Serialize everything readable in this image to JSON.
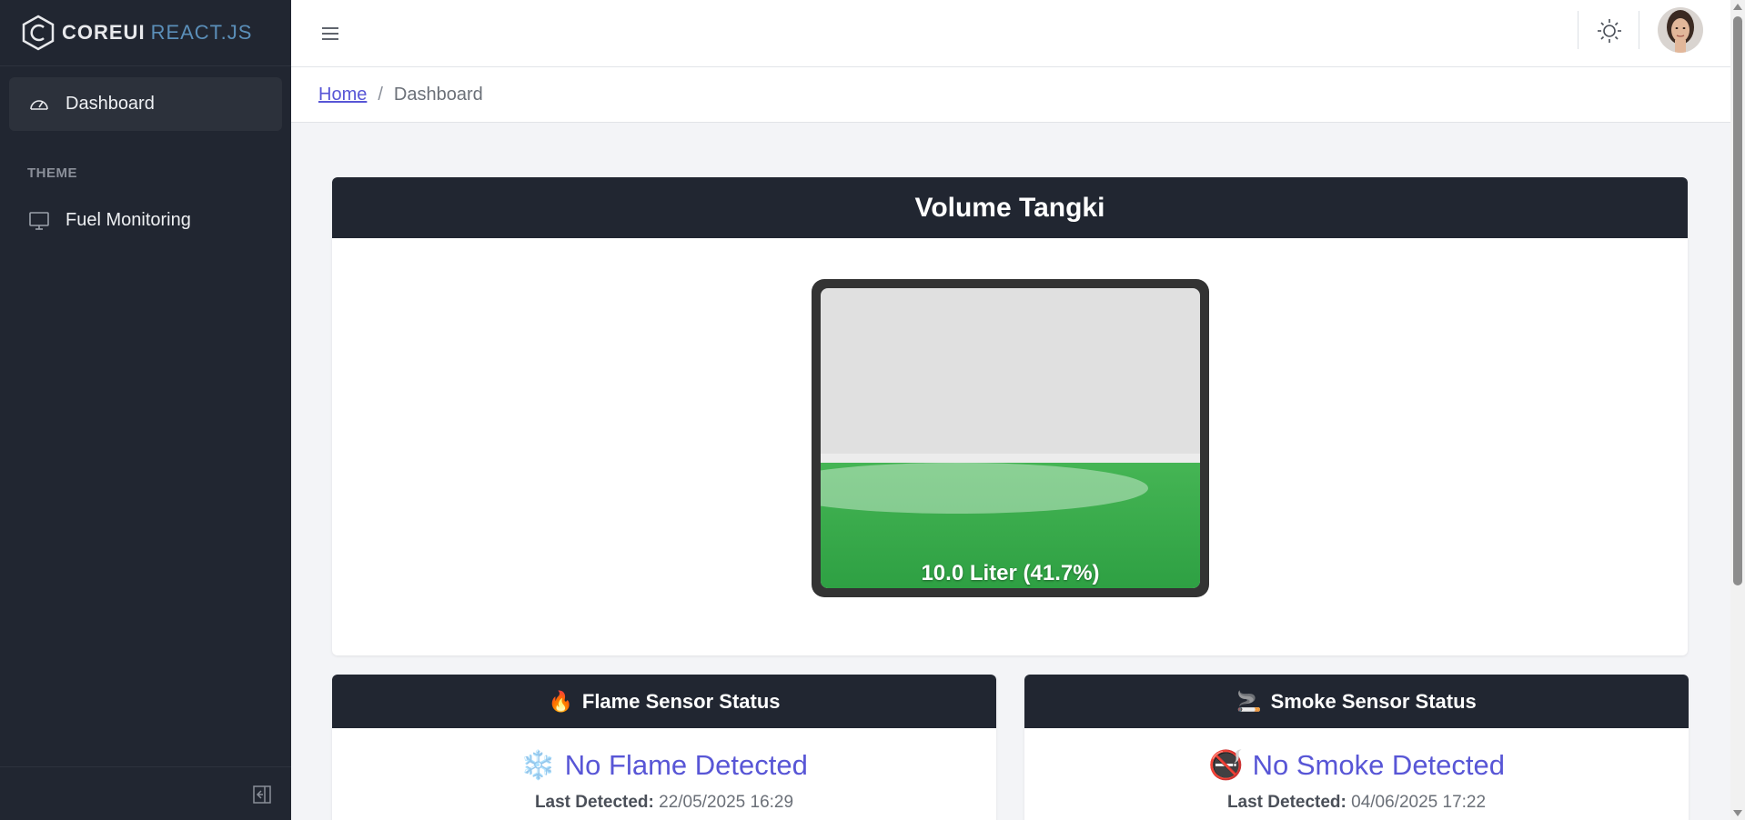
{
  "brand": {
    "core": "COREUI",
    "react": "REACT.JS"
  },
  "sidebar": {
    "items": [
      {
        "label": "Dashboard",
        "icon": "speedometer-icon"
      },
      {
        "label": "Fuel Monitoring",
        "icon": "monitor-icon"
      }
    ],
    "section_title": "THEME"
  },
  "breadcrumb": {
    "home": "Home",
    "separator": "/",
    "current": "Dashboard"
  },
  "volume": {
    "title": "Volume Tangki",
    "label": "10.0 Liter (41.7%)",
    "fill_fraction": 0.417
  },
  "flame": {
    "title": "Flame Sensor Status",
    "title_emoji": "🔥",
    "status_emoji": "❄️",
    "status": "No Flame Detected",
    "last_label": "Last Detected:",
    "last_value": "22/05/2025 16:29"
  },
  "smoke": {
    "title": "Smoke Sensor Status",
    "title_emoji": "🚬",
    "status_emoji": "🚭",
    "status": "No Smoke Detected",
    "last_label": "Last Detected:",
    "last_value": "04/06/2025 17:22"
  },
  "colors": {
    "sidebar": "#212631",
    "accent": "#5856d6",
    "liquid": "#2ea043"
  }
}
